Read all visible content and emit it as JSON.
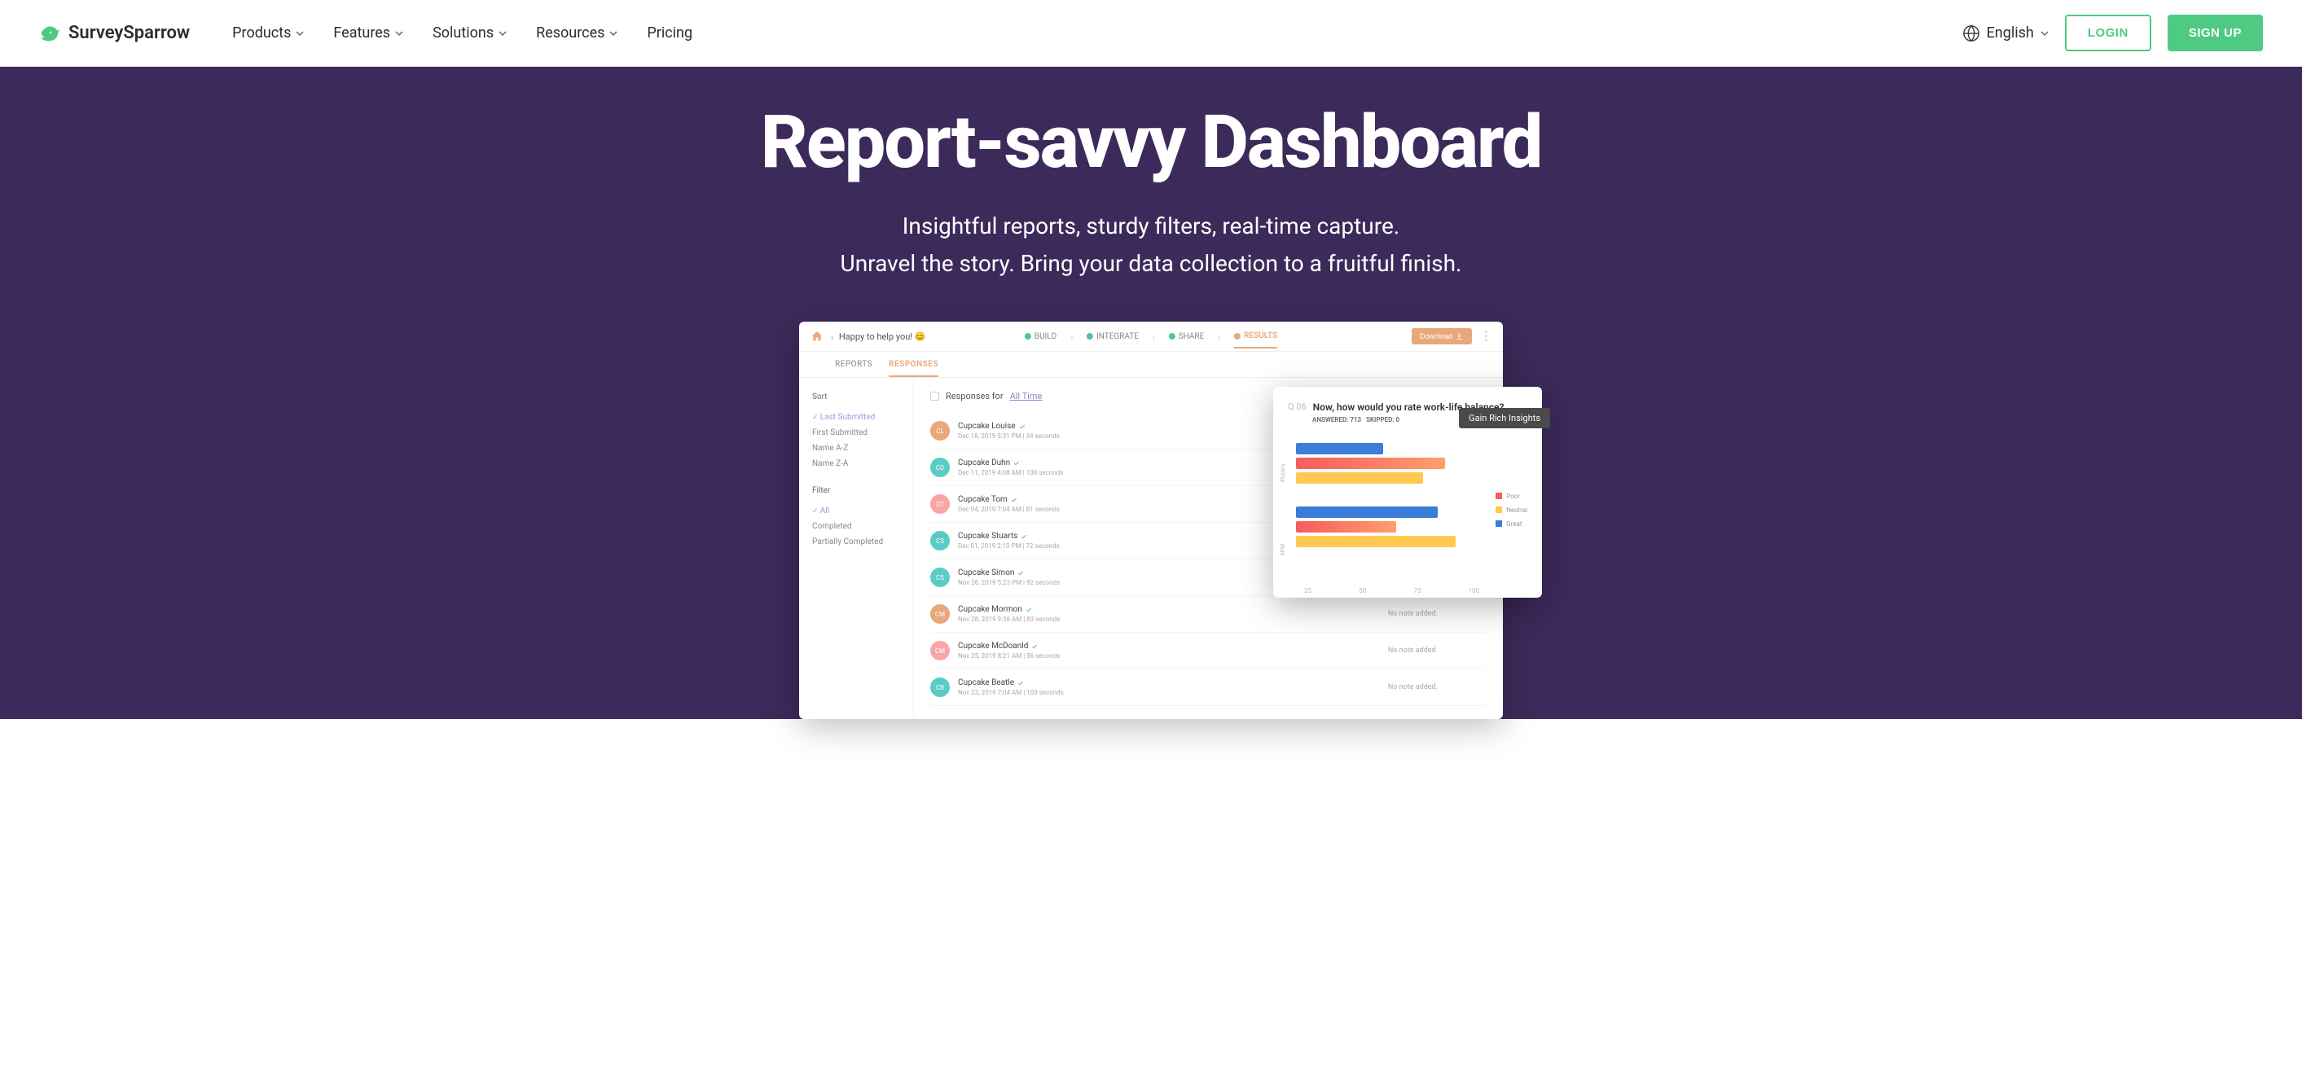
{
  "header": {
    "brand": "SurveySparrow",
    "nav": [
      "Products",
      "Features",
      "Solutions",
      "Resources",
      "Pricing"
    ],
    "language": "English",
    "login": "LOGIN",
    "signup": "SIGN UP"
  },
  "hero": {
    "title": "Report-savvy Dashboard",
    "subtitle1": "Insightful reports, sturdy filters, real-time capture.",
    "subtitle2": "Unravel the story. Bring your data collection to a fruitful finish."
  },
  "dashboard": {
    "title": "Happy to help you! 😊",
    "steps": [
      "BUILD",
      "INTEGRATE",
      "SHARE",
      "RESULTS"
    ],
    "download": "Download",
    "tabs": [
      "REPORTS",
      "RESPONSES"
    ],
    "sidebar": {
      "sort_label": "Sort",
      "sort_items": [
        "Last Submitted",
        "First Submitted",
        "Name A-Z",
        "Name Z-A"
      ],
      "filter_label": "Filter",
      "filter_items": [
        "All",
        "Completed",
        "Partially Completed"
      ]
    },
    "responses_label": "Responses for",
    "alltime": "All Time",
    "no_note": "No note added.",
    "responses": [
      {
        "name": "Cupcake Louise",
        "meta": "Dec 18, 2019 5:31 PM | 34 seconds",
        "color": "#e8a87c",
        "initials": "CL"
      },
      {
        "name": "Cupcake Duhn",
        "meta": "Dec 11, 2019 4:08 AM | 100 seconds",
        "color": "#5bccc4",
        "initials": "CD"
      },
      {
        "name": "Cupcake Tom",
        "meta": "Dec 04, 2019 7:04 AM | 81 seconds",
        "color": "#f8a5a5",
        "initials": "CT"
      },
      {
        "name": "Cupcake Stuarts",
        "meta": "Dec 01, 2019 2:10 PM | 72 seconds",
        "color": "#5bccc4",
        "initials": "CS"
      },
      {
        "name": "Cupcake Simon",
        "meta": "Nov 26, 2019 5:23 PM | 92 seconds",
        "color": "#5bccc4",
        "initials": "CS"
      },
      {
        "name": "Cupcake Mormon",
        "meta": "Nov 28, 2019 9:36 AM | 83 seconds",
        "color": "#e8a87c",
        "initials": "CM"
      },
      {
        "name": "Cupcake McDoanld",
        "meta": "Nov 25, 2019 8:21 AM | 56 seconds",
        "color": "#f8a5a5",
        "initials": "CM"
      },
      {
        "name": "Cupcake Beatle",
        "meta": "Nov 23, 2019 7:04 AM | 103 seconds",
        "color": "#5bccc4",
        "initials": "CB"
      }
    ]
  },
  "insights": {
    "q_num": "Q 06",
    "q_text": "Now, how would you rate work-life balance?",
    "answered_label": "ANSWERED:",
    "answered": "713",
    "skipped_label": "SKIPPED:",
    "skipped": "0",
    "tooltip": "Gain Rich Insights",
    "legend": [
      {
        "label": "Poor",
        "color": "#f55c5c"
      },
      {
        "label": "Neutral",
        "color": "#ffc850"
      },
      {
        "label": "Great",
        "color": "#3b7dd8"
      }
    ],
    "y_axis": [
      "#Salary",
      "#PM"
    ],
    "x_axis": [
      "25",
      "50",
      "75",
      "100"
    ]
  },
  "chart_data": {
    "type": "bar",
    "title": "Now, how would you rate work-life balance?",
    "xlabel": "",
    "ylabel": "",
    "xlim": [
      0,
      110
    ],
    "categories": [
      "#Salary",
      "#PM"
    ],
    "series": [
      {
        "name": "Great",
        "color": "#3b7dd8",
        "values": [
          48,
          78
        ]
      },
      {
        "name": "Poor",
        "color": "#f55c5c",
        "values": [
          82,
          55
        ]
      },
      {
        "name": "Neutral",
        "color": "#ffc850",
        "values": [
          70,
          88
        ]
      }
    ]
  }
}
